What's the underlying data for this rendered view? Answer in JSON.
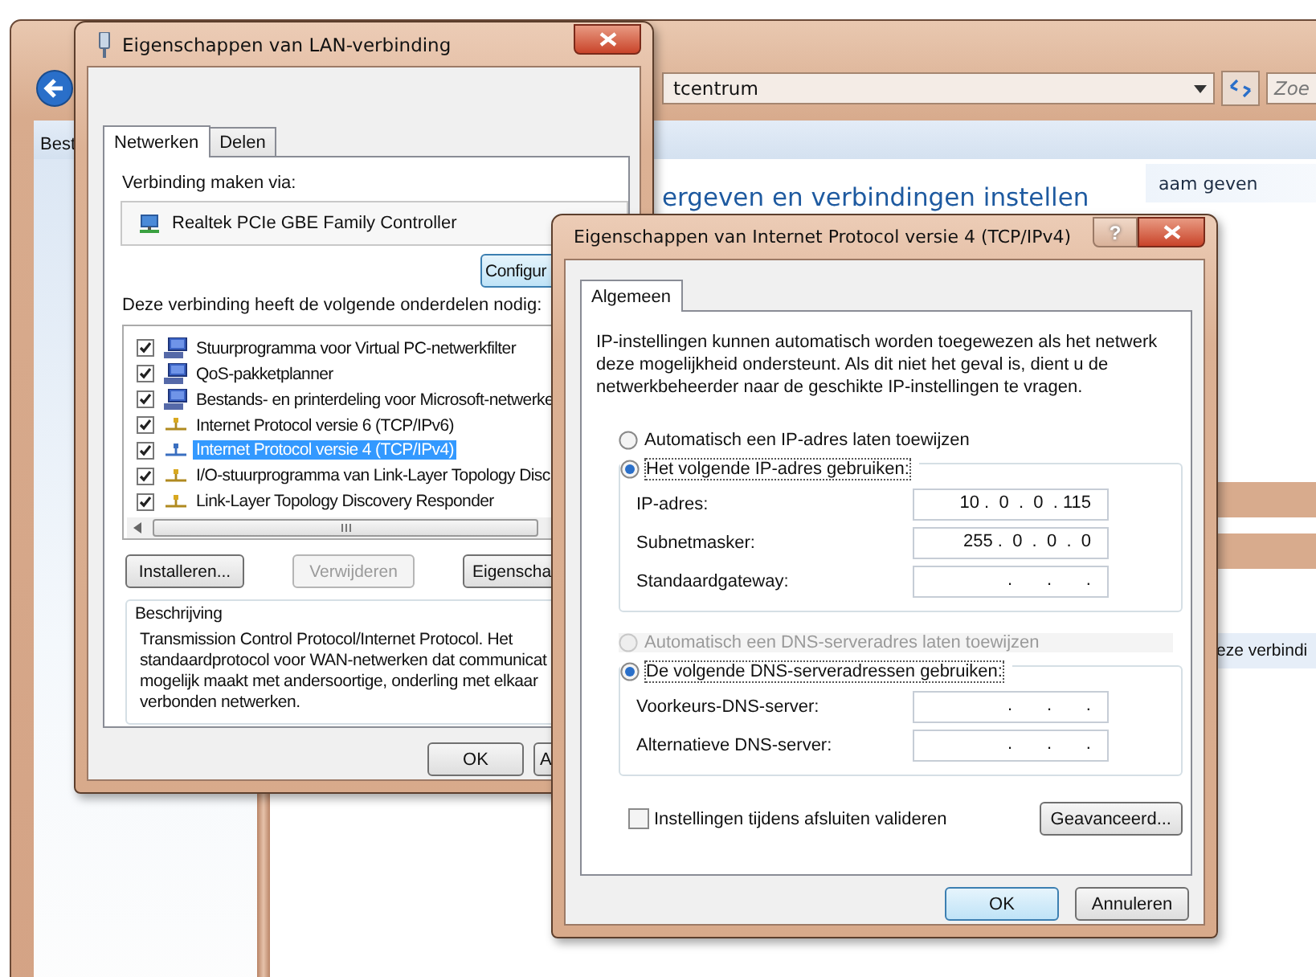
{
  "background_window": {
    "menu_item": "Best",
    "address": "tcentrum",
    "search_placeholder": "Zoe",
    "task_link": "aam geven",
    "heading": "ergeven en verbindingen instellen"
  },
  "side_window": {
    "link": "eze verbindi"
  },
  "lan_dialog": {
    "title": "Eigenschappen van LAN-verbinding",
    "tabs": [
      {
        "label": "Netwerken",
        "selected": true
      },
      {
        "label": "Delen",
        "selected": false
      }
    ],
    "connect_via_label": "Verbinding maken via:",
    "adapter": "Realtek PCIe GBE Family Controller",
    "configure_button": "Configur",
    "components_label": "Deze verbinding heeft de volgende onderdelen nodig:",
    "components": [
      {
        "label": "Stuurprogramma voor Virtual PC-netwerkfilter",
        "kind": "service",
        "checked": true,
        "selected": false
      },
      {
        "label": "QoS-pakketplanner",
        "kind": "service",
        "checked": true,
        "selected": false
      },
      {
        "label": "Bestands- en printerdeling voor Microsoft-netwerke",
        "kind": "service",
        "checked": true,
        "selected": false
      },
      {
        "label": "Internet Protocol versie 6 (TCP/IPv6)",
        "kind": "protocol",
        "checked": true,
        "selected": false
      },
      {
        "label": "Internet Protocol versie 4 (TCP/IPv4)",
        "kind": "protocol",
        "checked": true,
        "selected": true
      },
      {
        "label": "I/O-stuurprogramma van Link-Layer Topology Disc",
        "kind": "protocol",
        "checked": true,
        "selected": false
      },
      {
        "label": "Link-Layer Topology Discovery Responder",
        "kind": "protocol",
        "checked": true,
        "selected": false
      }
    ],
    "buttons": [
      {
        "label": "Installeren...",
        "disabled": false
      },
      {
        "label": "Verwijderen",
        "disabled": true
      },
      {
        "label": "Eigenscha",
        "disabled": false
      }
    ],
    "description_title": "Beschrijving",
    "description_lines": [
      "Transmission Control Protocol/Internet Protocol. Het",
      "standaardprotocol voor WAN-netwerken dat communicat",
      "mogelijk maakt met andersoortige, onderling met elkaar",
      "verbonden netwerken."
    ],
    "footer_buttons": [
      "OK",
      "A"
    ]
  },
  "ipv4_dialog": {
    "title": "Eigenschappen van Internet Protocol versie 4 (TCP/IPv4)",
    "help_button": "?",
    "tabs": [
      {
        "label": "Algemeen",
        "selected": true
      }
    ],
    "intro": "IP-instellingen kunnen automatisch worden toegewezen als het netwerk deze mogelijkheid ondersteunt. Als dit niet het geval is, dient u de netwerkbeheerder naar de geschikte IP-instellingen te vragen.",
    "ip_options": [
      {
        "label": "Automatisch een IP-adres laten toewijzen",
        "selected": false,
        "disabled": false
      },
      {
        "label": "Het volgende IP-adres gebruiken:",
        "selected": true,
        "disabled": false
      }
    ],
    "ip_fields": [
      {
        "label": "IP-adres:",
        "value": "10 .  0  .  0  . 115"
      },
      {
        "label": "Subnetmasker:",
        "value": "255 .  0  .  0  .  0"
      },
      {
        "label": "Standaardgateway:",
        "value": ".       .       ."
      }
    ],
    "dns_options": [
      {
        "label": "Automatisch een DNS-serveradres laten toewijzen",
        "selected": false,
        "disabled": true
      },
      {
        "label": "De volgende DNS-serveradressen gebruiken:",
        "selected": true,
        "disabled": false
      }
    ],
    "dns_fields": [
      {
        "label": "Voorkeurs-DNS-server:",
        "value": ".       .       ."
      },
      {
        "label": "Alternatieve DNS-server:",
        "value": ".       .       ."
      }
    ],
    "validate_checkbox": {
      "label": "Instellingen tijdens afsluiten valideren",
      "checked": false
    },
    "advanced_button": "Geavanceerd...",
    "buttons": [
      {
        "label": "OK",
        "default": true
      },
      {
        "label": "Annuleren",
        "default": false
      }
    ]
  }
}
